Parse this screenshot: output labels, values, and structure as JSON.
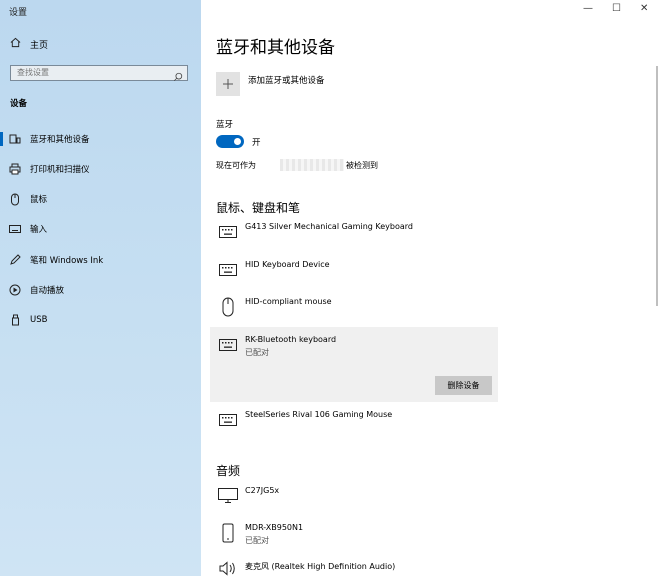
{
  "window": {
    "title": "设置",
    "minimize": "—",
    "maximize": "☐",
    "close": "✕"
  },
  "sidebar": {
    "home_label": "主页",
    "search_placeholder": "查找设置",
    "section": "设备",
    "items": [
      {
        "label": "蓝牙和其他设备",
        "icon": "bluetooth-devices-icon",
        "active": true
      },
      {
        "label": "打印机和扫描仪",
        "icon": "printer-icon",
        "active": false
      },
      {
        "label": "鼠标",
        "icon": "mouse-icon",
        "active": false
      },
      {
        "label": "输入",
        "icon": "keyboard-icon",
        "active": false
      },
      {
        "label": "笔和 Windows Ink",
        "icon": "pen-icon",
        "active": false
      },
      {
        "label": "自动播放",
        "icon": "autoplay-icon",
        "active": false
      },
      {
        "label": "USB",
        "icon": "usb-icon",
        "active": false
      }
    ]
  },
  "main": {
    "title": "蓝牙和其他设备",
    "add_device_label": "添加蓝牙或其他设备",
    "bluetooth": {
      "label": "蓝牙",
      "state": "开",
      "on": true
    },
    "discoverable_prefix": "现在可作为",
    "discoverable_suffix": "被检测到",
    "input_group": {
      "title": "鼠标、键盘和笔",
      "devices": [
        {
          "name": "G413 Silver Mechanical Gaming Keyboard",
          "status": "",
          "icon": "keyboard-icon"
        },
        {
          "name": "HID Keyboard Device",
          "status": "",
          "icon": "keyboard-icon"
        },
        {
          "name": "HID-compliant mouse",
          "status": "",
          "icon": "mouse-icon"
        },
        {
          "name": "RK-Bluetooth keyboard",
          "status": "已配对",
          "icon": "keyboard-icon",
          "selected": true
        },
        {
          "name": "SteelSeries Rival 106 Gaming Mouse",
          "status": "",
          "icon": "keyboard-icon"
        }
      ],
      "remove_label": "删除设备"
    },
    "audio_group": {
      "title": "音频",
      "devices": [
        {
          "name": "C27JG5x",
          "status": "",
          "icon": "monitor-icon"
        },
        {
          "name": "MDR-XB950N1",
          "status": "已配对",
          "icon": "phone-icon"
        },
        {
          "name": "麦克风 (Realtek High Definition Audio)",
          "status": "",
          "icon": "speaker-icon"
        }
      ]
    }
  }
}
